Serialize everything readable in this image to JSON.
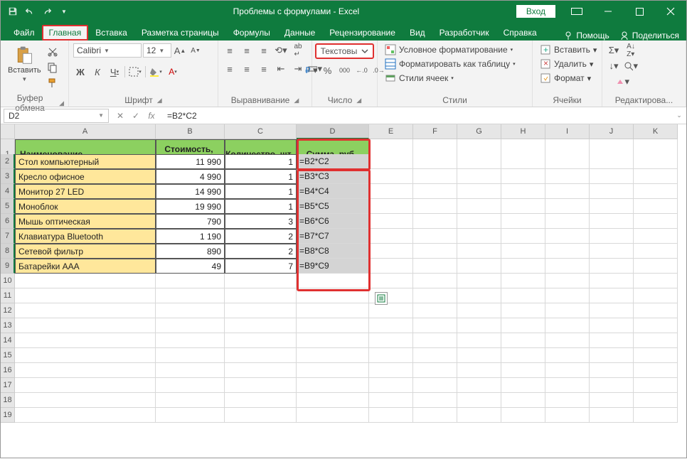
{
  "title": "Проблемы с формулами  -  Excel",
  "login": "Вход",
  "tabs": {
    "file": "Файл",
    "home": "Главная",
    "insert": "Вставка",
    "layout": "Разметка страницы",
    "formulas": "Формулы",
    "data": "Данные",
    "review": "Рецензирование",
    "view": "Вид",
    "developer": "Разработчик",
    "help": "Справка",
    "assist": "Помощь",
    "share": "Поделиться"
  },
  "ribbon": {
    "clipboard": {
      "paste": "Вставить",
      "label": "Буфер обмена"
    },
    "font": {
      "name": "Calibri",
      "size": "12",
      "label": "Шрифт"
    },
    "align": {
      "label": "Выравнивание"
    },
    "number": {
      "format": "Текстовы",
      "label": "Число"
    },
    "styles": {
      "cond": "Условное форматирование",
      "table": "Форматировать как таблицу",
      "cell": "Стили ячеек",
      "label": "Стили"
    },
    "cells": {
      "insert": "Вставить",
      "delete": "Удалить",
      "format": "Формат",
      "label": "Ячейки"
    },
    "editing": {
      "label": "Редактирова..."
    }
  },
  "namebox": "D2",
  "formula": "=B2*C2",
  "columns": [
    "A",
    "B",
    "C",
    "D",
    "E",
    "F",
    "G",
    "H",
    "I",
    "J",
    "K"
  ],
  "headers": {
    "name": "Наименование",
    "cost": "Стоимость, руб.",
    "qty": "Количество, шт.",
    "sum": "Сумма, руб."
  },
  "rows": [
    {
      "n": "Стол компьютерный",
      "c": "11 990",
      "q": "1",
      "s": "=B2*C2"
    },
    {
      "n": "Кресло офисное",
      "c": "4 990",
      "q": "1",
      "s": "=B3*C3"
    },
    {
      "n": "Монитор 27 LED",
      "c": "14 990",
      "q": "1",
      "s": "=B4*C4"
    },
    {
      "n": "Моноблок",
      "c": "19 990",
      "q": "1",
      "s": "=B5*C5"
    },
    {
      "n": "Мышь оптическая",
      "c": "790",
      "q": "3",
      "s": "=B6*C6"
    },
    {
      "n": "Клавиатура Bluetooth",
      "c": "1 190",
      "q": "2",
      "s": "=B7*C7"
    },
    {
      "n": "Сетевой фильтр",
      "c": "890",
      "q": "2",
      "s": "=B8*C8"
    },
    {
      "n": "Батарейки AAA",
      "c": "49",
      "q": "7",
      "s": "=B9*C9"
    }
  ],
  "chart_data": {
    "type": "table",
    "columns": [
      "Наименование",
      "Стоимость, руб.",
      "Количество, шт.",
      "Сумма, руб."
    ],
    "data": [
      [
        "Стол компьютерный",
        11990,
        1,
        "=B2*C2"
      ],
      [
        "Кресло офисное",
        4990,
        1,
        "=B3*C3"
      ],
      [
        "Монитор 27 LED",
        14990,
        1,
        "=B4*C4"
      ],
      [
        "Моноблок",
        19990,
        1,
        "=B5*C5"
      ],
      [
        "Мышь оптическая",
        790,
        3,
        "=B6*C6"
      ],
      [
        "Клавиатура Bluetooth",
        1190,
        2,
        "=B7*C7"
      ],
      [
        "Сетевой фильтр",
        890,
        2,
        "=B8*C8"
      ],
      [
        "Батарейки AAA",
        49,
        7,
        "=B9*C9"
      ]
    ]
  }
}
